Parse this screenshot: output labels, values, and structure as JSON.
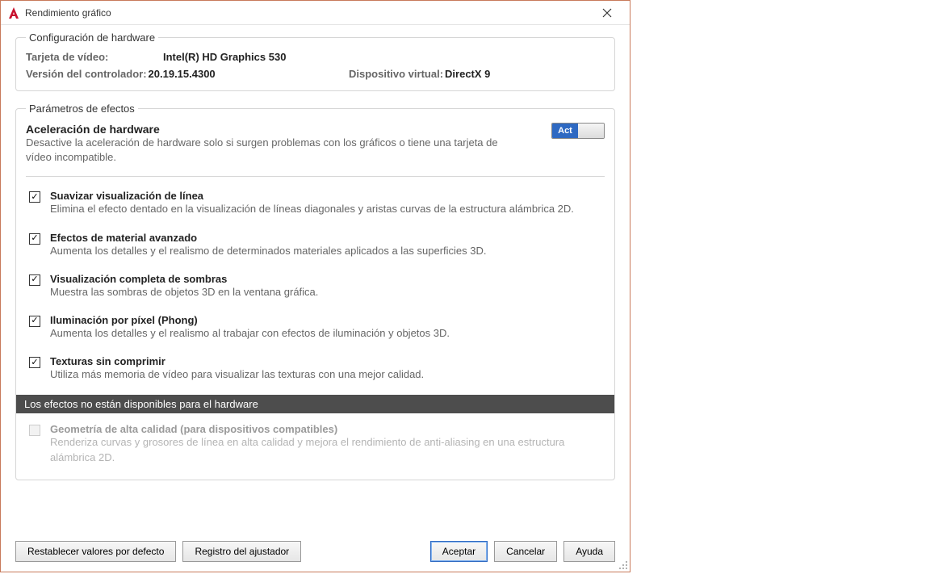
{
  "title": "Rendimiento gráfico",
  "hardware": {
    "legend": "Configuración de hardware",
    "video_card_label": "Tarjeta de vídeo:",
    "video_card_value": "Intel(R) HD Graphics 530",
    "driver_label": "Versión del controlador:",
    "driver_value": "20.19.15.4300",
    "virtual_label": "Dispositivo virtual:",
    "virtual_value": "DirectX 9"
  },
  "effects": {
    "legend": "Parámetros de efectos",
    "accel_title": "Aceleración de hardware",
    "accel_desc": "Desactive la aceleración de hardware solo si surgen problemas con los gráficos o tiene una tarjeta de vídeo incompatible.",
    "toggle_on": "Act",
    "options": [
      {
        "checked": true,
        "title": "Suavizar visualización de línea",
        "desc": "Elimina el efecto dentado en la visualización de líneas diagonales y aristas curvas de la estructura alámbrica 2D."
      },
      {
        "checked": true,
        "title": "Efectos de material avanzado",
        "desc": "Aumenta los detalles y el realismo de determinados materiales aplicados a las superficies 3D."
      },
      {
        "checked": true,
        "title": "Visualización completa de sombras",
        "desc": "Muestra las sombras de objetos 3D en la ventana gráfica."
      },
      {
        "checked": true,
        "title": "Iluminación por píxel (Phong)",
        "desc": "Aumenta los detalles y el realismo al trabajar con efectos de iluminación y objetos 3D."
      },
      {
        "checked": true,
        "title": "Texturas sin comprimir",
        "desc": "Utiliza más memoria de vídeo para visualizar las texturas con una mejor calidad."
      }
    ],
    "unavailable_header": "Los efectos no están disponibles para el hardware",
    "disabled_option": {
      "title": "Geometría de alta calidad (para dispositivos compatibles)",
      "desc": "Renderiza curvas y grosores de línea en alta calidad  y mejora el rendimiento de anti-aliasing en una estructura alámbrica 2D."
    }
  },
  "buttons": {
    "restore": "Restablecer valores por defecto",
    "tuner": "Registro del ajustador",
    "ok": "Aceptar",
    "cancel": "Cancelar",
    "help": "Ayuda"
  }
}
